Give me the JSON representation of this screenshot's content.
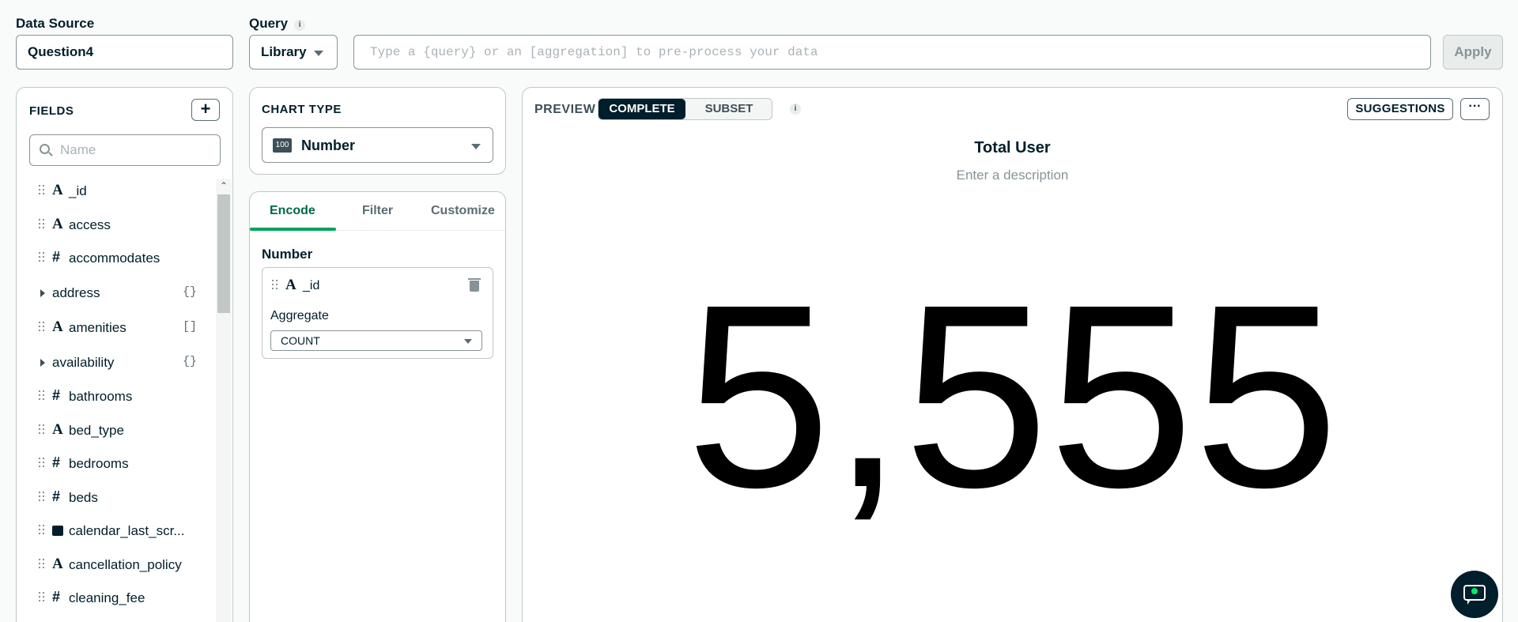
{
  "top": {
    "data_source_label": "Data Source",
    "data_source_value": "Question4",
    "query_label": "Query",
    "query_info": "i",
    "library_value": "Library",
    "query_placeholder": "Type a {query} or an [aggregation] to pre-process your data",
    "apply_label": "Apply"
  },
  "fields_panel": {
    "title": "FIELDS",
    "add_label": "+",
    "search_placeholder": "Name",
    "items": [
      {
        "type": "A",
        "name": "_id"
      },
      {
        "type": "A",
        "name": "access"
      },
      {
        "type": "#",
        "name": "accommodates"
      },
      {
        "type": "object",
        "name": "address",
        "badge": "{}"
      },
      {
        "type": "A",
        "name": "amenities",
        "badge": "[]"
      },
      {
        "type": "object",
        "name": "availability",
        "badge": "{}"
      },
      {
        "type": "#",
        "name": "bathrooms"
      },
      {
        "type": "A",
        "name": "bed_type"
      },
      {
        "type": "#",
        "name": "bedrooms"
      },
      {
        "type": "#",
        "name": "beds"
      },
      {
        "type": "date",
        "name": "calendar_last_scr..."
      },
      {
        "type": "A",
        "name": "cancellation_policy"
      },
      {
        "type": "#",
        "name": "cleaning_fee"
      }
    ]
  },
  "chart_type": {
    "title": "CHART TYPE",
    "icon_text": "100",
    "selected": "Number"
  },
  "encode": {
    "tabs": [
      "Encode",
      "Filter",
      "Customize"
    ],
    "active_tab": "Encode",
    "channel_label": "Number",
    "field_type": "A",
    "field_name": "_id",
    "aggregate_label": "Aggregate",
    "aggregate_value": "COUNT"
  },
  "preview": {
    "label": "PREVIEW",
    "seg_complete": "COMPLETE",
    "seg_subset": "SUBSET",
    "info": "i",
    "suggestions_label": "SUGGESTIONS",
    "more_label": "···",
    "title": "Total User",
    "description_placeholder": "Enter a description",
    "value": "5,555"
  }
}
